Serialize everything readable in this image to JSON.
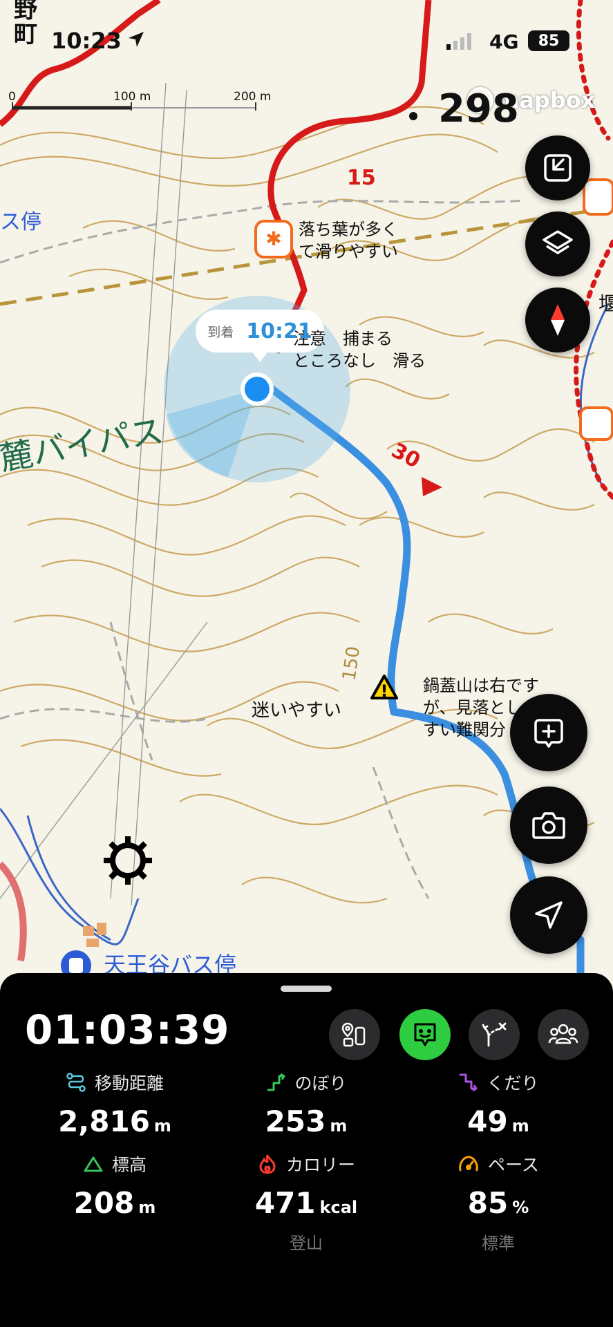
{
  "status_bar": {
    "time": "10:23",
    "network": "4G",
    "battery": "85",
    "corner_label_1": "野",
    "corner_label_2": "町"
  },
  "map": {
    "attribution": "mapbox",
    "scale": {
      "zero": "0",
      "mid": "100 m",
      "end": "200 m"
    },
    "peak_elevation": "298",
    "contour_label": "150",
    "segment_time_1": "15",
    "segment_time_2": "30",
    "place_bus_stop_1": "ス停",
    "place_bus_stop_2": "天王谷バス停",
    "road_name": "麓バイパス",
    "right_edge_label": "堰",
    "notes": {
      "leaves_1": "落ち葉が多く",
      "leaves_2": "て滑りやすい",
      "caution_1": "注意　捕まる",
      "caution_2": "ところなし　滑る",
      "lost": "迷いやすい",
      "nabe_1": "鍋蓋山は右です",
      "nabe_2": "が、見落とし",
      "nabe_3": "すい難関分"
    },
    "eta": {
      "label": "到着",
      "time": "10:21"
    }
  },
  "bottom_sheet": {
    "elapsed_time": "01:03:39",
    "stats": [
      {
        "label": "移動距離",
        "value": "2,816",
        "unit": "m",
        "icon": "route-icon",
        "color": "#5ac8e0"
      },
      {
        "label": "のぼり",
        "value": "253",
        "unit": "m",
        "icon": "ascent-icon",
        "color": "#34c759"
      },
      {
        "label": "くだり",
        "value": "49",
        "unit": "m",
        "icon": "descent-icon",
        "color": "#af52de"
      },
      {
        "label": "標高",
        "value": "208",
        "unit": "m",
        "icon": "mountain-icon",
        "color": "#34c759"
      },
      {
        "label": "カロリー",
        "value": "471",
        "unit": "kcal",
        "icon": "flame-icon",
        "color": "#ff3b30",
        "sub": "登山"
      },
      {
        "label": "ペース",
        "value": "85",
        "unit": "%",
        "icon": "speedometer-icon",
        "color": "#ff9f0a",
        "sub": "標準"
      }
    ]
  },
  "colors": {
    "route_blue": "#3a8fe0",
    "trail_red": "#e01e1e",
    "contour": "#c9a257",
    "accent_green": "#2ecc40"
  }
}
